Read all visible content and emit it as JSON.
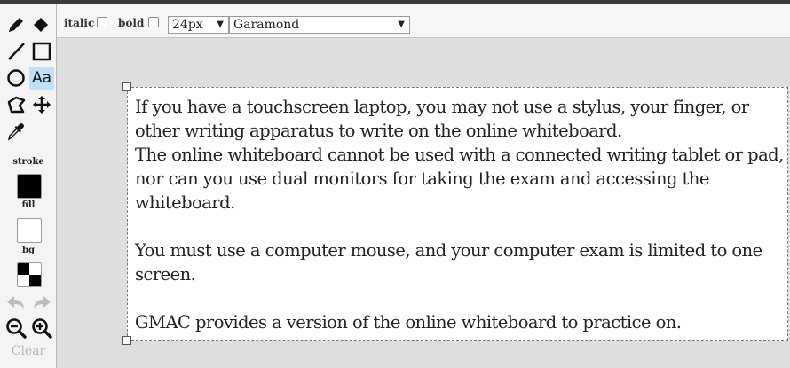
{
  "toolbox": {
    "active_tool": "text",
    "tools": [
      {
        "name": "pencil-tool",
        "icon": "pencil-icon"
      },
      {
        "name": "eraser-tool",
        "icon": "eraser-icon"
      },
      {
        "name": "line-tool",
        "icon": "line-icon"
      },
      {
        "name": "rectangle-tool",
        "icon": "rectangle-icon"
      },
      {
        "name": "ellipse-tool",
        "icon": "ellipse-icon"
      },
      {
        "name": "text-tool",
        "icon": "text-icon",
        "label": "Aa"
      },
      {
        "name": "polygon-tool",
        "icon": "polygon-icon"
      },
      {
        "name": "move-tool",
        "icon": "move-icon"
      },
      {
        "name": "eyedropper-tool",
        "icon": "eyedropper-icon"
      }
    ],
    "stroke_label": "stroke",
    "fill_label": "fill",
    "bg_label": "bg",
    "stroke_color": "#000000",
    "fill_color": "#ffffff",
    "clear_label": "Clear"
  },
  "options": {
    "italic_label": "italic",
    "bold_label": "bold",
    "font_size": "24px",
    "font_family": "Garamond"
  },
  "textbox": {
    "lines": [
      "If you have a touchscreen laptop, you may not use a stylus, your finger, or",
      "other writing apparatus to write on the online whiteboard.",
      "The online whiteboard cannot be used with a connected writing tablet or pad,",
      "nor can you use dual monitors for taking the exam and accessing the",
      "whiteboard.",
      "",
      "You must use a computer mouse, and your computer exam is limited to one",
      "screen.",
      "",
      "GMAC provides a version of the online whiteboard to practice on."
    ]
  }
}
